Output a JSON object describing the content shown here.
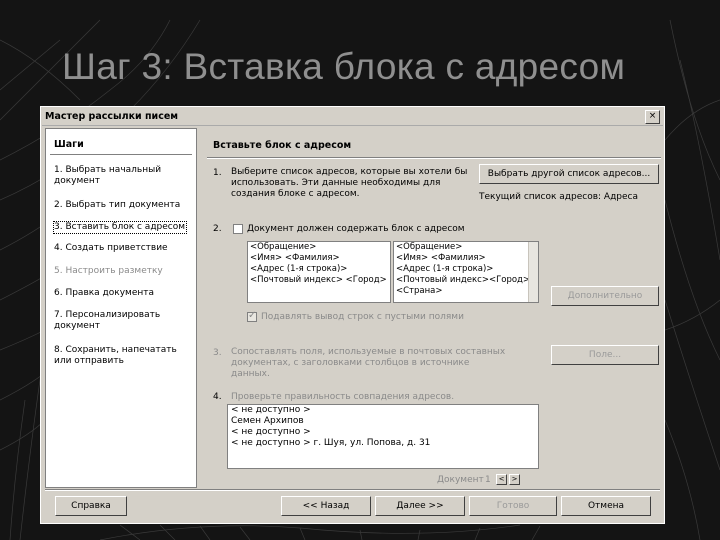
{
  "slide": {
    "title": "Шаг 3: Вставка блока с адресом"
  },
  "dialog": {
    "title": "Мастер рассылки писем",
    "close_glyph": "×",
    "steps_header": "Шаги",
    "steps": [
      {
        "label": "1. Выбрать начальный документ",
        "state": "normal"
      },
      {
        "label": "2. Выбрать тип документа",
        "state": "normal"
      },
      {
        "label": "3. Вставить блок с адресом",
        "state": "selected"
      },
      {
        "label": "4. Создать приветствие",
        "state": "normal"
      },
      {
        "label": "5. Настроить разметку",
        "state": "disabled"
      },
      {
        "label": "6. Правка документа",
        "state": "normal"
      },
      {
        "label": "7. Персонализировать документ",
        "state": "normal"
      },
      {
        "label": "8. Сохранить, напечатать или отправить",
        "state": "normal"
      }
    ],
    "page_title": "Вставьте блок с адресом",
    "s1": {
      "num": "1.",
      "text": "Выберите список адресов, которые вы хотели бы использовать. Эти данные необходимы для создания блоке с адресом.",
      "button": "Выбрать другой список адресов...",
      "current_list": "Текущий список адресов: Адреса"
    },
    "s2": {
      "num": "2.",
      "checkbox_label": "Документ должен содержать блок с адресом",
      "block_left": [
        "<Обращение>",
        "<Имя> <Фамилия>",
        "<Адрес (1-я строка)>",
        "<Почтовый индекс> <Город>"
      ],
      "block_right": [
        "<Обращение>",
        "<Имя> <Фамилия>",
        "<Адрес (1-я строка)>",
        "<Почтовый индекс><Город>",
        "<Страна>"
      ],
      "more_button": "Дополнительно",
      "suppress_label": "Подавлять вывод строк с пустыми полями"
    },
    "s3": {
      "num": "3.",
      "text": "Сопоставлять поля, используемые в почтовых составных документах, с заголовками столбцов в источнике данных.",
      "button": "Поле..."
    },
    "s4": {
      "num": "4.",
      "text": "Проверьте правильность совпадения адресов.",
      "preview": [
        "< не доступно >",
        "Семен Архипов",
        "< не доступно >",
        "< не доступно > г. Шуя, ул. Попова, д. 31"
      ],
      "doc_label": "Документ",
      "doc_number": "1",
      "prev_glyph": "<",
      "next_glyph": ">"
    },
    "buttons": {
      "help": "Справка",
      "back": "<< Назад",
      "next": "Далее >>",
      "finish": "Готово",
      "cancel": "Отмена"
    }
  }
}
